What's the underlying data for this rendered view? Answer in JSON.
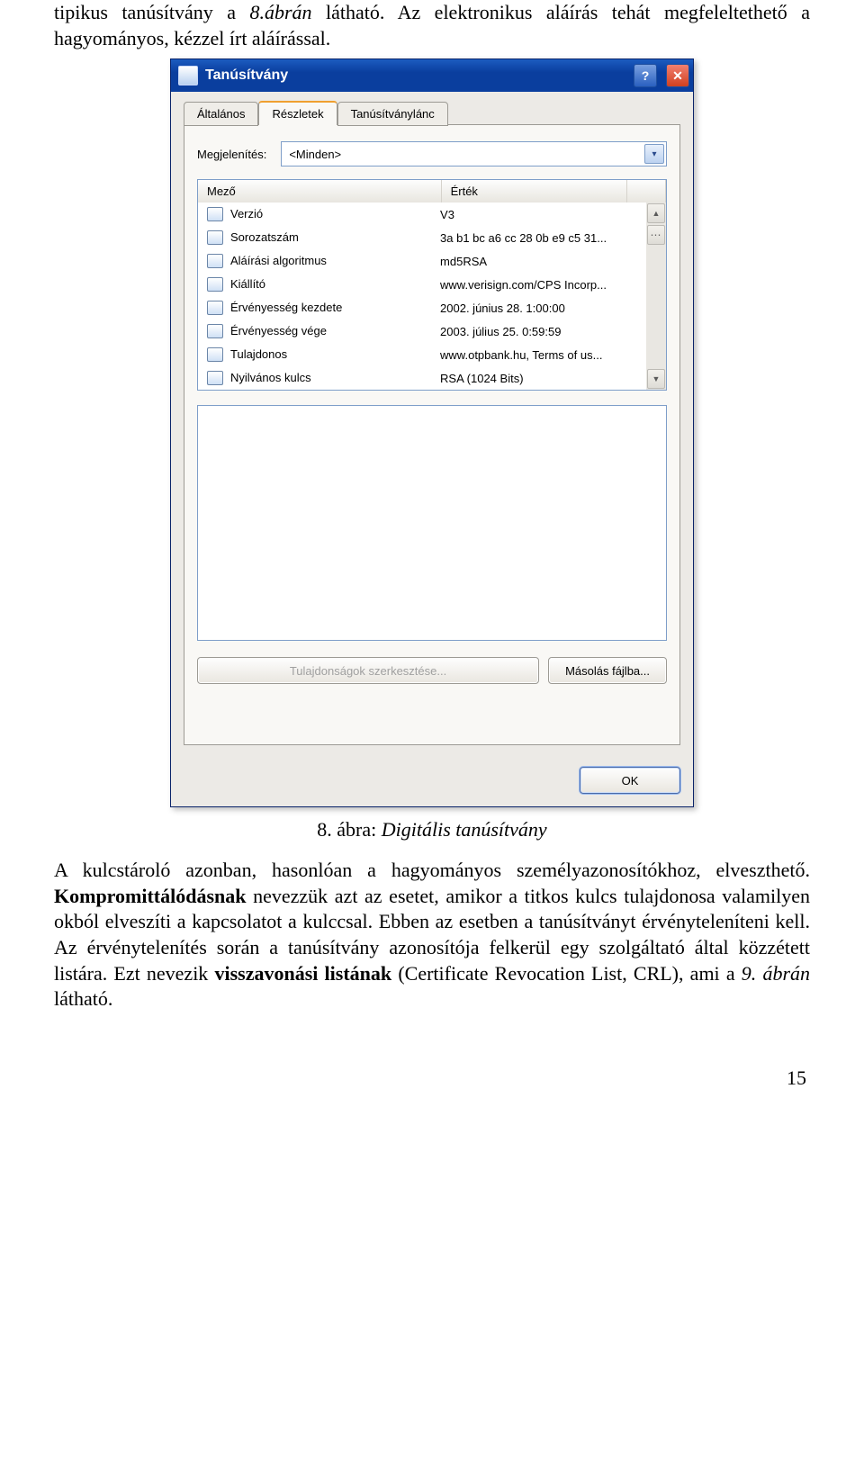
{
  "para_top_1": "tipikus tanúsítvány a ",
  "para_top_2": "8.ábrán",
  "para_top_3": " látható. Az elektronikus aláírás tehát megfeleltethető a hagyományos, kézzel írt aláírással.",
  "dialog": {
    "title": "Tanúsítvány",
    "tabs": [
      "Általános",
      "Részletek",
      "Tanúsítványlánc"
    ],
    "display_label": "Megjelenítés:",
    "display_value": "<Minden>",
    "col_field": "Mező",
    "col_value": "Érték",
    "rows": [
      {
        "field": "Verzió",
        "value": "V3"
      },
      {
        "field": "Sorozatszám",
        "value": "3a b1 bc a6 cc 28 0b e9 c5 31..."
      },
      {
        "field": "Aláírási algoritmus",
        "value": "md5RSA"
      },
      {
        "field": "Kiállító",
        "value": "www.verisign.com/CPS Incorp..."
      },
      {
        "field": "Érvényesség kezdete",
        "value": "2002. június 28. 1:00:00"
      },
      {
        "field": "Érvényesség vége",
        "value": "2003. július 25. 0:59:59"
      },
      {
        "field": "Tulajdonos",
        "value": "www.otpbank.hu, Terms of us..."
      },
      {
        "field": "Nyilvános kulcs",
        "value": "RSA (1024 Bits)"
      }
    ],
    "btn_edit": "Tulajdonságok szerkesztése...",
    "btn_copy": "Másolás fájlba...",
    "btn_ok": "OK"
  },
  "caption_num": "8. ábra:",
  "caption_txt": " Digitális tanúsítvány",
  "para_bottom": "A kulcstároló azonban, hasonlóan a hagyományos személyazonosítókhoz, elveszthető. Kompromittálódásnak nevezzük azt az esetet, amikor a titkos kulcs tulajdonosa valamilyen okból elveszíti a kapcsolatot a kulccsal. Ebben az esetben a tanúsítványt érvényteleníteni kell. Az érvénytelenítés során a tanúsítvány azonosítója felkerül egy szolgáltató által közzétett listára. Ezt nevezik visszavonási listának (Certificate Revocation List, CRL), ami a 9. ábrán látható.",
  "b1": "Kompromittálódásnak",
  "b2": "visszavonási listának",
  "page_number": "15"
}
